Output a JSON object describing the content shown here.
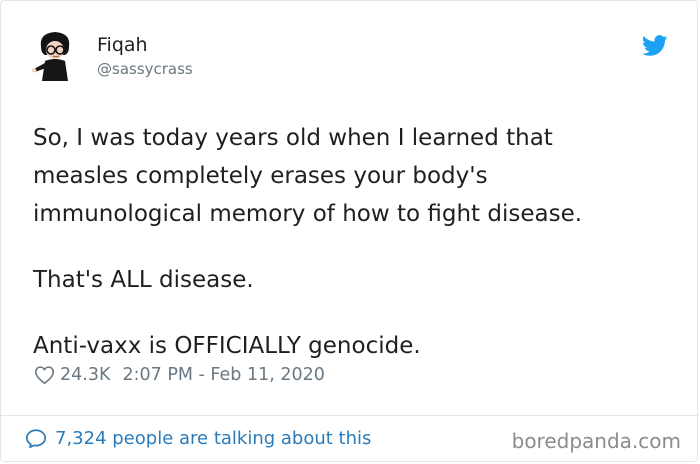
{
  "tweet": {
    "display_name": "Fiqah",
    "handle": "@sassycrass",
    "lines": [
      "So, I was today years old when I learned that",
      "measles completely erases your body's",
      "immunological memory of how to fight disease."
    ],
    "paragraph2": "That's ALL disease.",
    "paragraph3": "Anti-vaxx is OFFICIALLY genocide.",
    "likes": "24.3K",
    "timestamp": "2:07 PM - Feb 11, 2020"
  },
  "footer": {
    "talking": "7,324 people are talking about this",
    "watermark": "boredpanda.com"
  },
  "icons": {
    "platform": "twitter-bird-icon",
    "like": "heart-icon",
    "reply": "speech-bubble-icon"
  },
  "colors": {
    "twitter_blue": "#1da1f2",
    "link_blue": "#2b7bb9",
    "muted_gray": "#697882",
    "text": "#1c2022",
    "border": "#e1e8ed"
  }
}
